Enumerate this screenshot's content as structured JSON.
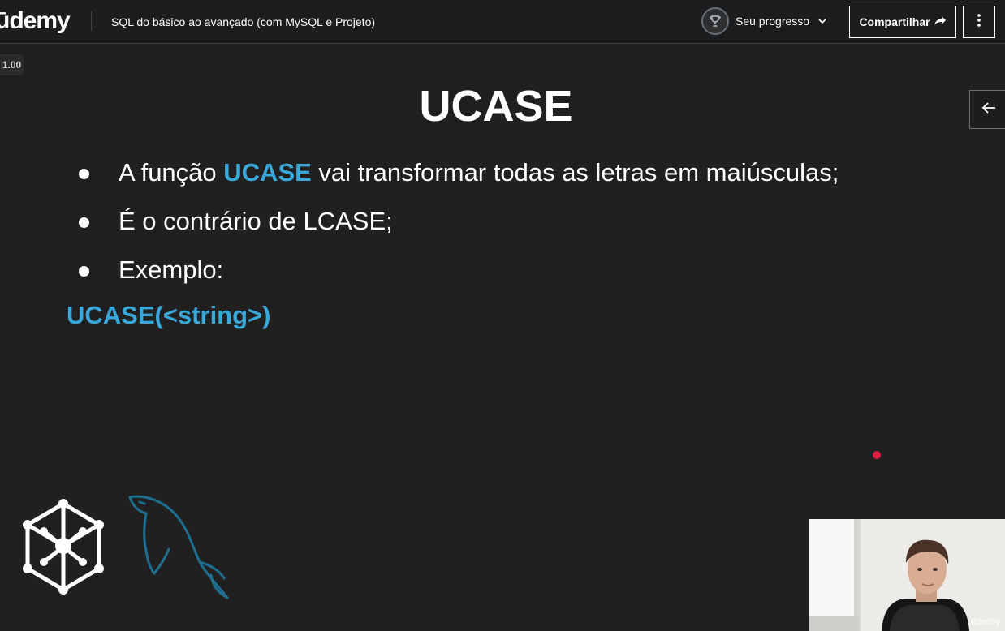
{
  "header": {
    "logo_text": "ūdemy",
    "course_title": "SQL do básico ao avançado (com MySQL e Projeto)",
    "progress_label": "Seu progresso",
    "share_label": "Compartilhar"
  },
  "player": {
    "speed": "1.00"
  },
  "slide": {
    "title": "UCASE",
    "bullets": [
      {
        "before": "A função ",
        "highlight": "UCASE",
        "after": " vai transformar todas as letras em maiúsculas;"
      },
      {
        "before": "É o contrário de LCASE;",
        "highlight": "",
        "after": ""
      },
      {
        "before": "Exemplo:",
        "highlight": "",
        "after": ""
      }
    ],
    "syntax": "UCASE(<string>)"
  },
  "webcam": {
    "watermark": "ūdemy"
  },
  "icons": {
    "trophy": "trophy-icon",
    "chevron": "chevron-down-icon",
    "share": "share-arrow-icon",
    "more": "more-vertical-icon",
    "side": "arrow-left-icon"
  },
  "colors": {
    "brand": "#a435f0",
    "highlight": "#3aa7d9",
    "background": "#1c1d1f",
    "recording_dot": "#e02040"
  }
}
